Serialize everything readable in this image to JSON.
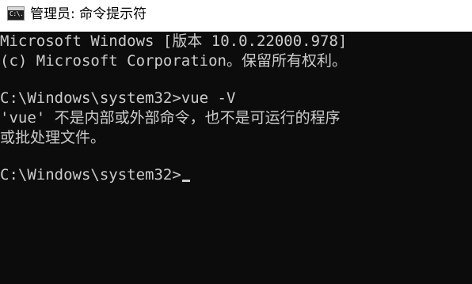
{
  "window": {
    "title": "管理员: 命令提示符",
    "icon": "cmd-icon",
    "icon_glyph": "C:\\."
  },
  "console": {
    "lines": [
      "Microsoft Windows [版本 10.0.22000.978]",
      "(c) Microsoft Corporation。保留所有权利。",
      "",
      "C:\\Windows\\system32>vue -V",
      "'vue' 不是内部或外部命令，也不是可运行的程序",
      "或批处理文件。",
      "",
      "C:\\Windows\\system32>"
    ]
  },
  "colors": {
    "console_background": "#0c0c0c",
    "console_text": "#cccccc",
    "titlebar_background": "#ffffff",
    "title_text": "#000000"
  }
}
